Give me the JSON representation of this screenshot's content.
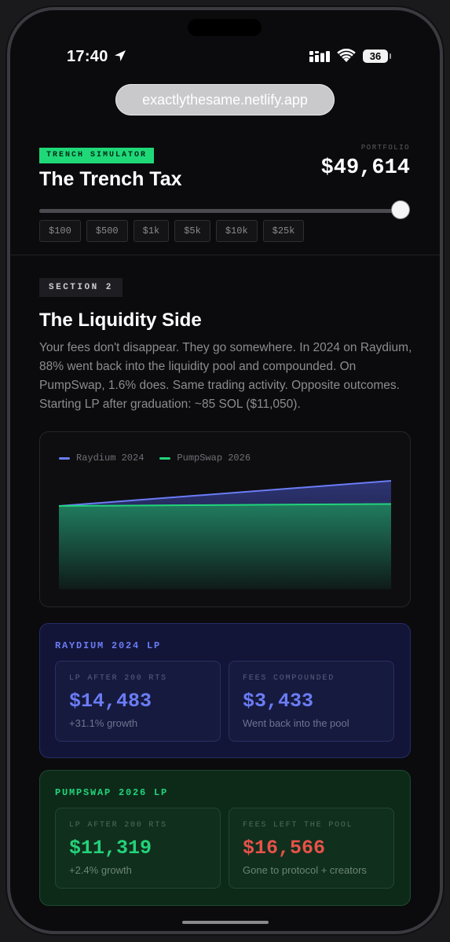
{
  "status_bar": {
    "time": "17:40",
    "battery": "36"
  },
  "browser": {
    "url": "exactlythesame.netlify.app"
  },
  "header": {
    "badge": "TRENCH SIMULATOR",
    "title": "The Trench Tax",
    "portfolio_label": "PORTFOLIO",
    "portfolio_value": "$49,614"
  },
  "slider": {
    "level_fraction": 1.0
  },
  "presets": [
    "$100",
    "$500",
    "$1k",
    "$5k",
    "$10k",
    "$25k"
  ],
  "section": {
    "badge": "SECTION 2",
    "title": "The Liquidity Side",
    "body": "Your fees don't disappear. They go somewhere. In 2024 on Raydium, 88% went back into the liquidity pool and compounded. On PumpSwap, 1.6% does. Same trading activity. Opposite outcomes. Starting LP after graduation: ~85 SOL ($11,050)."
  },
  "chart_data": {
    "type": "area",
    "x": [
      0,
      200
    ],
    "series": [
      {
        "name": "Raydium 2024",
        "values": [
          11050,
          14483
        ],
        "color": "#6b7cf5"
      },
      {
        "name": "PumpSwap 2026",
        "values": [
          11050,
          11319
        ],
        "color": "#22d37a"
      }
    ],
    "ylim": [
      0,
      15000
    ],
    "legend": "top-left",
    "grid": false
  },
  "raydium_card": {
    "heading": "RAYDIUM 2024 LP",
    "accent": "#6b7cf5",
    "stat1": {
      "label": "LP AFTER 200 RTS",
      "value": "$14,483",
      "sub": "+31.1% growth"
    },
    "stat2": {
      "label": "FEES COMPOUNDED",
      "value": "$3,433",
      "sub": "Went back into the pool"
    }
  },
  "pumpswap_card": {
    "heading": "PUMPSWAP 2026 LP",
    "accent": "#22d37a",
    "negative": "#e8524a",
    "stat1": {
      "label": "LP AFTER 200 RTS",
      "value": "$11,319",
      "sub": "+2.4% growth"
    },
    "stat2": {
      "label": "FEES LEFT THE POOL",
      "value": "$16,566",
      "sub": "Gone to protocol + creators"
    }
  }
}
